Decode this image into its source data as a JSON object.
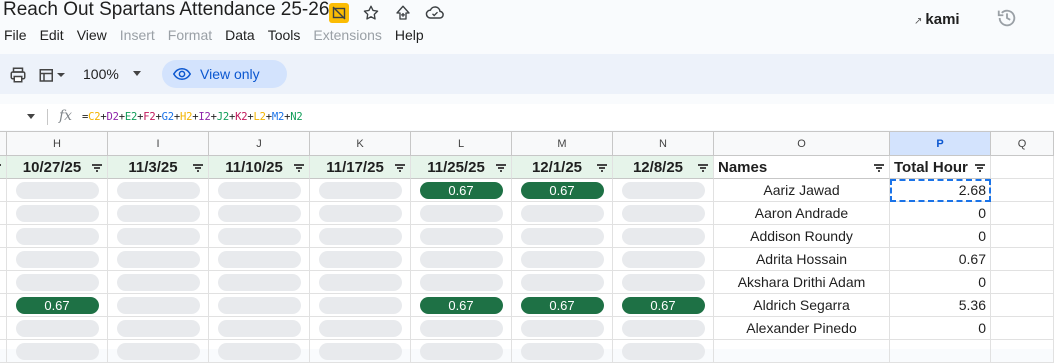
{
  "title": "Reach Out Spartans Attendance 25-26",
  "title_icons": [
    "drive-not-synced-icon",
    "star-icon",
    "move-to-folder-icon",
    "cloud-status-icon"
  ],
  "kami": {
    "label": "kami",
    "icon": "external-link-icon"
  },
  "history_icon": "version-history-icon",
  "menu": [
    "File",
    "Edit",
    "View",
    "Insert",
    "Format",
    "Data",
    "Tools",
    "Extensions",
    "Help"
  ],
  "menu_disabled": [
    "Insert",
    "Format",
    "Extensions"
  ],
  "toolbar": {
    "zoom": "100%",
    "view_only": "View only"
  },
  "formula": {
    "fx": "fx",
    "tokens": [
      {
        "t": "=",
        "c": "#1f1f1f"
      },
      {
        "t": "C2",
        "c": "#f4b400"
      },
      {
        "t": "+",
        "c": "#1f1f1f"
      },
      {
        "t": "D2",
        "c": "#8e24aa"
      },
      {
        "t": "+",
        "c": "#1f1f1f"
      },
      {
        "t": "E2",
        "c": "#0f9d58"
      },
      {
        "t": "+",
        "c": "#1f1f1f"
      },
      {
        "t": "F2",
        "c": "#c2185b"
      },
      {
        "t": "+",
        "c": "#1f1f1f"
      },
      {
        "t": "G2",
        "c": "#1a73e8"
      },
      {
        "t": "+",
        "c": "#1f1f1f"
      },
      {
        "t": "H2",
        "c": "#f4b400"
      },
      {
        "t": "+",
        "c": "#1f1f1f"
      },
      {
        "t": "I2",
        "c": "#8e24aa"
      },
      {
        "t": "+",
        "c": "#1f1f1f"
      },
      {
        "t": "J2",
        "c": "#0f9d58"
      },
      {
        "t": "+",
        "c": "#1f1f1f"
      },
      {
        "t": "K2",
        "c": "#c2185b"
      },
      {
        "t": "+",
        "c": "#1f1f1f"
      },
      {
        "t": "L2",
        "c": "#f4b400"
      },
      {
        "t": "+",
        "c": "#1f1f1f"
      },
      {
        "t": "M2",
        "c": "#1a73e8"
      },
      {
        "t": "+",
        "c": "#1f1f1f"
      },
      {
        "t": "N2",
        "c": "#0f9d58"
      }
    ]
  },
  "columns": [
    "H",
    "I",
    "J",
    "K",
    "L",
    "M",
    "N",
    "O",
    "P",
    "Q"
  ],
  "active_column": "P",
  "headers": {
    "dates": [
      "10/27/25",
      "11/3/25",
      "11/10/25",
      "11/17/25",
      "11/25/25",
      "12/1/25",
      "12/8/25"
    ],
    "names": "Names",
    "total": "Total Hour"
  },
  "rows": [
    {
      "chips": [
        "",
        "",
        "",
        "",
        "0.67",
        "0.67",
        ""
      ],
      "name": "Aariz Jawad",
      "total": "2.68"
    },
    {
      "chips": [
        "",
        "",
        "",
        "",
        "",
        "",
        ""
      ],
      "name": "Aaron Andrade",
      "total": "0"
    },
    {
      "chips": [
        "",
        "",
        "",
        "",
        "",
        "",
        ""
      ],
      "name": "Addison Roundy",
      "total": "0"
    },
    {
      "chips": [
        "",
        "",
        "",
        "",
        "",
        "",
        ""
      ],
      "name": "Adrita Hossain",
      "total": "0.67"
    },
    {
      "chips": [
        "",
        "",
        "",
        "",
        "",
        "",
        ""
      ],
      "name": "Akshara Drithi Adam",
      "total": "0"
    },
    {
      "chips": [
        "0.67",
        "",
        "",
        "",
        "0.67",
        "0.67",
        "0.67"
      ],
      "name": "Aldrich Segarra",
      "total": "5.36"
    },
    {
      "chips": [
        "",
        "",
        "",
        "",
        "",
        "",
        ""
      ],
      "name": "Alexander Pinedo",
      "total": "0"
    },
    {
      "chips": [
        "",
        "",
        "",
        "",
        "",
        "",
        ""
      ],
      "name": "",
      "total": ""
    }
  ],
  "colors": {
    "chip_on": "#1e7145",
    "chip_off": "#e8eaed",
    "accent": "#0b57d0",
    "date_header_tint": "#e6f4ea"
  }
}
